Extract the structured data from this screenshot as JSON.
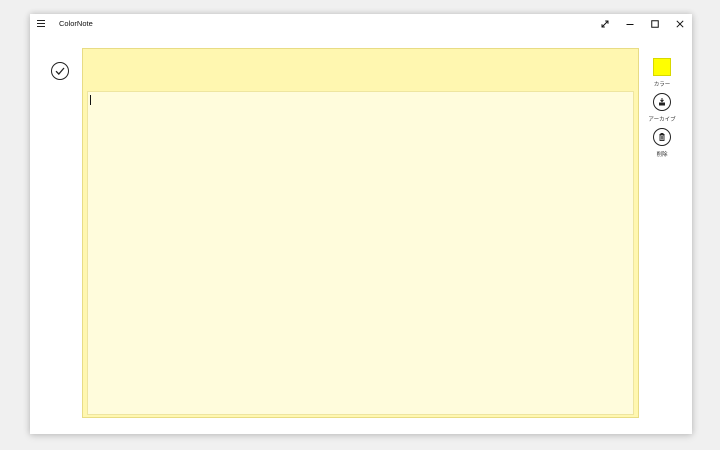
{
  "app": {
    "title": "ColorNote"
  },
  "window_controls": {
    "expand": "expand-icon",
    "minimize": "minimize-icon",
    "maximize": "maximize-icon",
    "close": "close-icon"
  },
  "note": {
    "color_name": "yellow",
    "header_color": "#fff7b0",
    "body_color": "#fffcdc",
    "body_text": ""
  },
  "side_tools": {
    "color": {
      "label": "カラー",
      "swatch": "#ffff00"
    },
    "archive": {
      "label": "アーカイブ",
      "icon": "archive-icon"
    },
    "delete": {
      "label": "削除",
      "icon": "trash-icon"
    }
  },
  "actions": {
    "done_icon": "checkmark-icon"
  }
}
